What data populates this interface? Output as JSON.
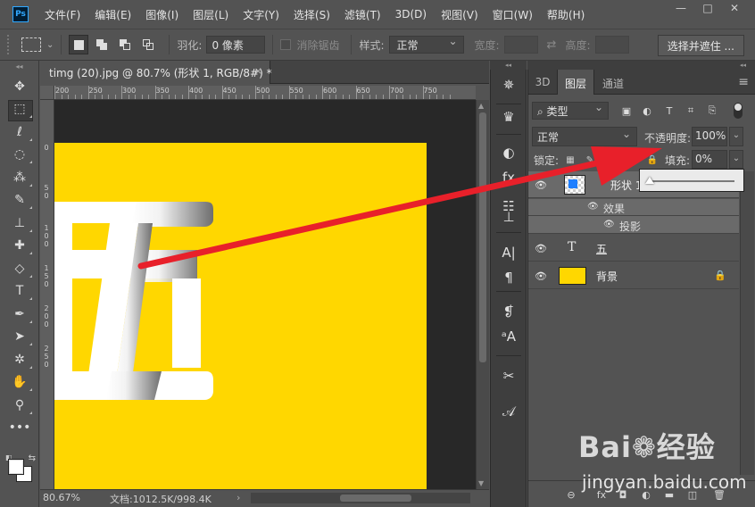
{
  "menubar": {
    "logo": "Ps",
    "items": [
      "文件(F)",
      "编辑(E)",
      "图像(I)",
      "图层(L)",
      "文字(Y)",
      "选择(S)",
      "滤镜(T)",
      "3D(D)",
      "视图(V)",
      "窗口(W)",
      "帮助(H)"
    ],
    "window_controls": [
      "—",
      "□",
      "✕"
    ]
  },
  "options_bar": {
    "feather_label": "羽化:",
    "feather_value": "0 像素",
    "antialias_label": "消除锯齿",
    "style_label": "样式:",
    "style_value": "正常",
    "width_label": "宽度:",
    "height_label": "高度:",
    "mask_button": "选择并遮住 ..."
  },
  "document": {
    "tab_title": "timg (20).jpg @ 80.7% (形状 1, RGB/8#) *",
    "tab_close": "×",
    "ruler_top_labels": [
      "200",
      "250",
      "300",
      "350",
      "400",
      "450",
      "500",
      "550",
      "600",
      "650",
      "700",
      "750"
    ],
    "ruler_left_labels": [
      [
        "0"
      ],
      [
        "5",
        "0"
      ],
      [
        "1",
        "0",
        "0"
      ],
      [
        "1",
        "5",
        "0"
      ],
      [
        "2",
        "0",
        "0"
      ],
      [
        "2",
        "5",
        "0"
      ]
    ],
    "canvas_glyph": "五",
    "colors": {
      "image_bg": "#FFD700",
      "pasteboard": "#282828",
      "glyph": "#FFFFFF"
    }
  },
  "status": {
    "zoom": "80.67%",
    "doc_info": "文档:1012.5K/998.4K",
    "arrow": "›"
  },
  "toolbar": {
    "tools": [
      {
        "name": "move-tool",
        "glyph": "✥"
      },
      {
        "name": "marquee-tool",
        "glyph": "⬚"
      },
      {
        "name": "lasso-tool",
        "glyph": "ℓ"
      },
      {
        "name": "quick-select-tool",
        "glyph": "◌"
      },
      {
        "name": "eyedropper-tool",
        "glyph": "⁂"
      },
      {
        "name": "brush-tool",
        "glyph": "✎"
      },
      {
        "name": "stamp-tool",
        "glyph": "⊥"
      },
      {
        "name": "healing-tool",
        "glyph": "✚"
      },
      {
        "name": "eraser-tool",
        "glyph": "◇"
      },
      {
        "name": "type-tool",
        "glyph": "T"
      },
      {
        "name": "pen-tool",
        "glyph": "✒"
      },
      {
        "name": "path-select-tool",
        "glyph": "➤"
      },
      {
        "name": "shape-tool",
        "glyph": "✲"
      },
      {
        "name": "hand-tool",
        "glyph": "✋"
      },
      {
        "name": "zoom-tool",
        "glyph": "⚲"
      },
      {
        "name": "more-tools",
        "glyph": "•••"
      }
    ],
    "head": "◂◂",
    "swatch_mini": "◧",
    "swatch_swap": "⇆",
    "foreground_color": "#FFFFFF",
    "background_color": "#FFFFFF"
  },
  "icon_dock": {
    "head": "◂◂",
    "buttons": [
      {
        "name": "navigator-icon",
        "glyph": "✵"
      },
      {
        "name": "histogram-icon",
        "glyph": "♛"
      },
      {
        "name": "adjust-icon",
        "glyph": "◐"
      },
      {
        "name": "fx-icon",
        "glyph": "fx"
      },
      {
        "name": "properties-icon",
        "glyph": "☷"
      },
      {
        "name": "stamp-clone-icon",
        "glyph": "⊥"
      },
      {
        "name": "character-icon",
        "glyph": "A|"
      },
      {
        "name": "paragraph-icon",
        "glyph": "¶"
      },
      {
        "name": "char-style-icon",
        "glyph": "❡"
      },
      {
        "name": "glyph-style-icon",
        "glyph": "ᵃA"
      },
      {
        "name": "tools-icon",
        "glyph": "✂"
      },
      {
        "name": "glyphs-icon",
        "glyph": "𝒜"
      }
    ]
  },
  "layers_panel": {
    "head": "◂◂",
    "tabs": [
      "3D",
      "图层",
      "通道"
    ],
    "active_tab": "图层",
    "menu_glyph": "≡",
    "filter_label": "⌕ 类型",
    "filter_icons": [
      "▣",
      "◐",
      "T",
      "⌗",
      "⎘"
    ],
    "blend_mode": "正常",
    "opacity_label": "不透明度:",
    "opacity_value": "100%",
    "lock_label": "锁定:",
    "lock_icons": [
      "▦",
      "✎",
      "✥",
      "⌑",
      "🔒"
    ],
    "fill_label": "填充:",
    "fill_value": "0%",
    "fill_slider_value": 0,
    "dropdown_glyph": "⌄",
    "eye_glyph": "👁",
    "layers": [
      {
        "name": "形状 1",
        "type": "shape",
        "selected": true
      },
      {
        "name": "效果",
        "type": "effect-group"
      },
      {
        "name": "投影",
        "type": "effect"
      },
      {
        "name": "五",
        "type": "text"
      },
      {
        "name": "背景",
        "type": "background",
        "locked": true
      }
    ],
    "text_thumb_glyph": "T",
    "lock_glyph": "🔒",
    "footer_icons": [
      "⊖",
      "fx",
      "◘",
      "◐",
      "▬",
      "◫",
      "🗑"
    ]
  },
  "annotation": {
    "arrow_color": "#E8202A"
  },
  "watermark": {
    "logo": "Bai❁经验",
    "url": "jingyan.baidu.com"
  }
}
